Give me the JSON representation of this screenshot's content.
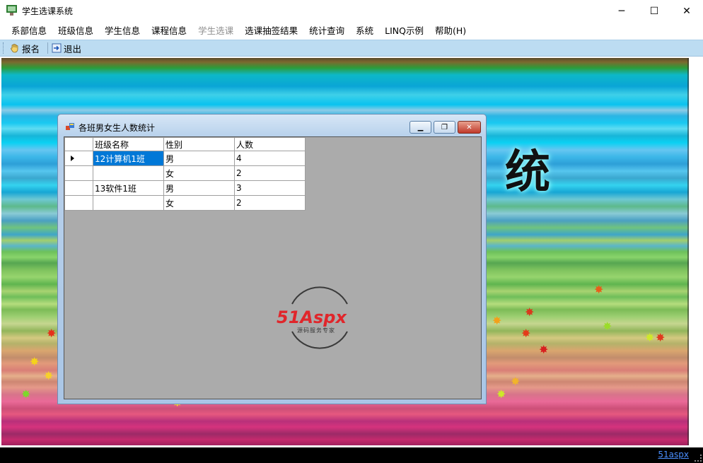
{
  "window": {
    "title": "学生选课系统",
    "controls": {
      "minimize": "─",
      "maximize": "☐",
      "close": "✕"
    }
  },
  "menu": [
    {
      "label": "系部信息",
      "enabled": true
    },
    {
      "label": "班级信息",
      "enabled": true
    },
    {
      "label": "学生信息",
      "enabled": true
    },
    {
      "label": "课程信息",
      "enabled": true
    },
    {
      "label": "学生选课",
      "enabled": false
    },
    {
      "label": "选课抽签结果",
      "enabled": true
    },
    {
      "label": "统计查询",
      "enabled": true
    },
    {
      "label": "系统",
      "enabled": true
    },
    {
      "label": "LINQ示例",
      "enabled": true
    },
    {
      "label": "帮助(H)",
      "enabled": true
    }
  ],
  "toolbar": {
    "signup_label": "报名",
    "exit_label": "退出"
  },
  "background": {
    "decor_text": "统"
  },
  "child_window": {
    "title": "各班男女生人数统计",
    "controls": {
      "minimize": "▁",
      "maximize": "❐",
      "close": "✕"
    },
    "grid": {
      "columns": [
        "班级名称",
        "性别",
        "人数"
      ],
      "rows": [
        {
          "class": "12计算机1班",
          "gender": "男",
          "count": "4",
          "current": true
        },
        {
          "class": "",
          "gender": "女",
          "count": "2",
          "current": false
        },
        {
          "class": "13软件1班",
          "gender": "男",
          "count": "3",
          "current": false
        },
        {
          "class": "",
          "gender": "女",
          "count": "2",
          "current": false
        }
      ]
    },
    "watermark": {
      "brand": "51Aspx",
      "tagline": "源码服务专家"
    }
  },
  "statusbar": {
    "link": "51aspx"
  },
  "colors": {
    "toolbar_bg": "#bcdcf2",
    "selection": "#0078d7",
    "client_bg": "#ababab",
    "logo_red": "#e0262b",
    "logo_green": "#2ca02c"
  }
}
